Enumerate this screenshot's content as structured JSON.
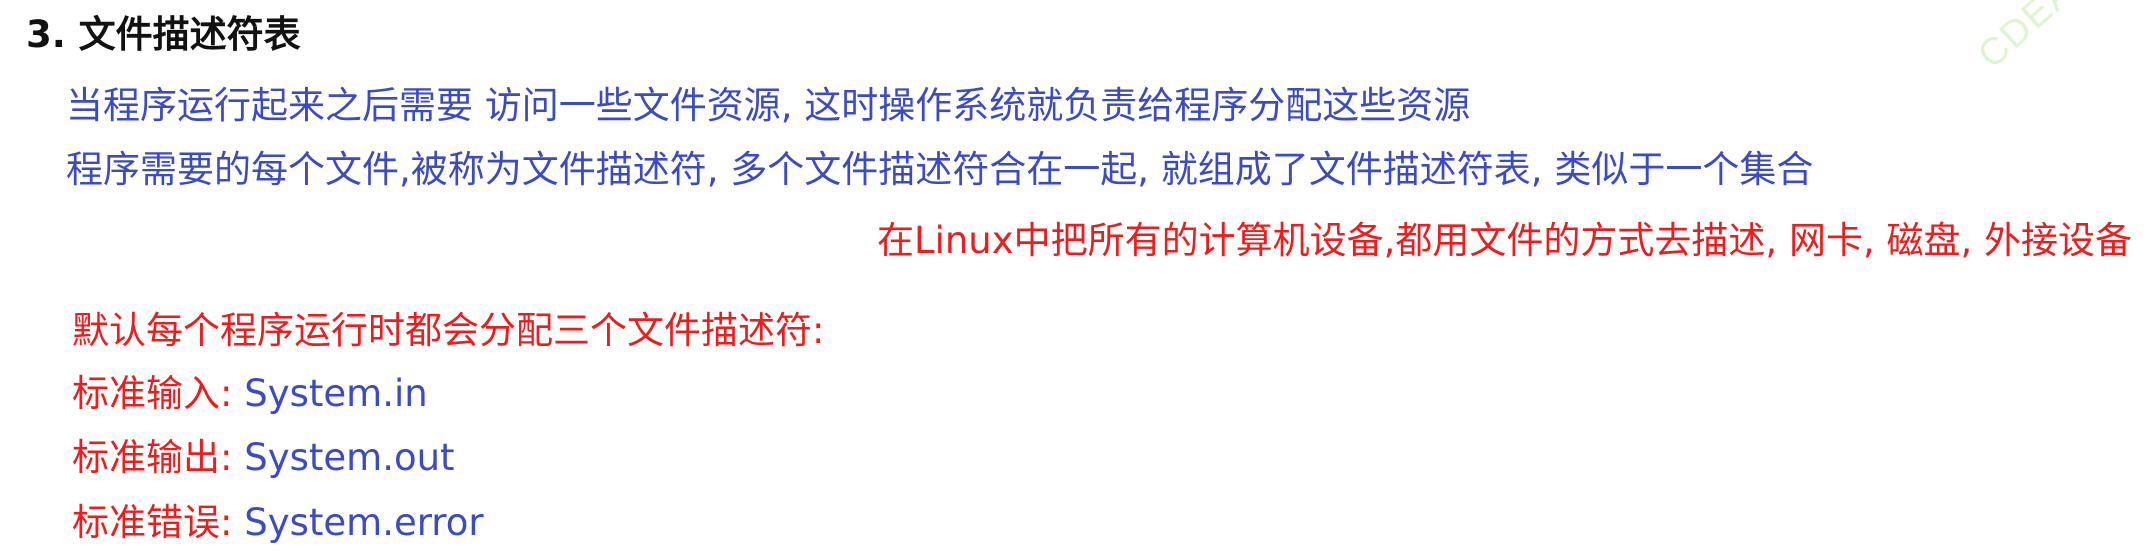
{
  "section": {
    "heading": "3. 文件描述符表"
  },
  "intro": {
    "line1": "当程序运行起来之后需要 访问一些文件资源, 这时操作系统就负责给程序分配这些资源",
    "line2": "程序需要的每个文件,被称为文件描述符, 多个文件描述符合在一起, 就组成了文件描述符表, 类似于一个集合"
  },
  "note": {
    "linux": "在Linux中把所有的计算机设备,都用文件的方式去描述,  网卡, 磁盘, 外接设备"
  },
  "defaults": {
    "intro": "默认每个程序运行时都会分配三个文件描述符:",
    "items": [
      {
        "label": "标准输入: ",
        "value": "System.in"
      },
      {
        "label": "标准输出: ",
        "value": "System.out"
      },
      {
        "label": "标准错误: ",
        "value": "System.error"
      }
    ]
  },
  "watermark": "CDEA",
  "colors": {
    "blue_text": "#3a4bc4",
    "red_text": "#ee1c1c",
    "heading": "#111111"
  }
}
